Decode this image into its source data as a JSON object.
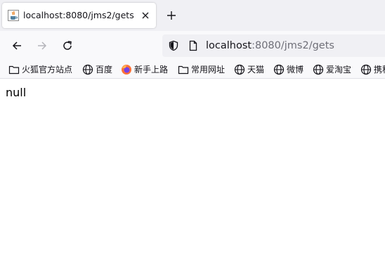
{
  "tab": {
    "title": "localhost:8080/jms2/gets",
    "favicon": "java-cup-icon",
    "close_icon": "close-icon"
  },
  "toolbar": {
    "new_tab_icon": "plus-icon",
    "back_icon": "arrow-left-icon",
    "forward_icon": "arrow-right-icon",
    "reload_icon": "reload-icon"
  },
  "urlbar": {
    "host": "localhost",
    "rest": ":8080/jms2/gets",
    "shield_icon": "shield-icon",
    "page_icon": "page-icon"
  },
  "bookmarks": [
    {
      "label": "火狐官方站点",
      "icon": "folder-icon"
    },
    {
      "label": "百度",
      "icon": "globe-icon"
    },
    {
      "label": "新手上路",
      "icon": "firefox-icon"
    },
    {
      "label": "常用网址",
      "icon": "folder-icon"
    },
    {
      "label": "天猫",
      "icon": "globe-icon"
    },
    {
      "label": "微博",
      "icon": "globe-icon"
    },
    {
      "label": "爱淘宝",
      "icon": "globe-icon"
    },
    {
      "label": "携程",
      "icon": "globe-icon"
    }
  ],
  "page": {
    "body_text": "null"
  },
  "colors": {
    "tabstrip_bg": "#f0f0f4",
    "toolbar_bg": "#f9f9fb",
    "url_rest": "#6f6f78"
  }
}
